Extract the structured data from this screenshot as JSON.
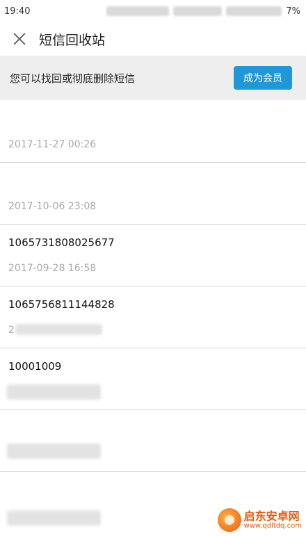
{
  "status_bar": {
    "time": "19:40",
    "battery": "7%"
  },
  "header": {
    "title": "短信回收站"
  },
  "banner": {
    "text": "您可以找回或彻底删除短信",
    "button_label": "成为会员"
  },
  "messages": [
    {
      "sender": "",
      "time": "2017-11-27 00:26"
    },
    {
      "sender": "",
      "time": "2017-10-06 23:08"
    },
    {
      "sender": "1065731808025677",
      "time": "2017-09-28 16:58"
    },
    {
      "sender": "1065756811144828",
      "time": "2"
    },
    {
      "sender": "10001009",
      "time": ""
    },
    {
      "sender": "",
      "time": ""
    },
    {
      "sender": "",
      "time": ""
    }
  ],
  "watermark": {
    "name": "启东安卓网",
    "url": "www.qdltdq.com"
  },
  "colors": {
    "accent": "#1e98d6",
    "banner_bg": "#eeeeee",
    "timestamp": "#a8a8a8"
  }
}
